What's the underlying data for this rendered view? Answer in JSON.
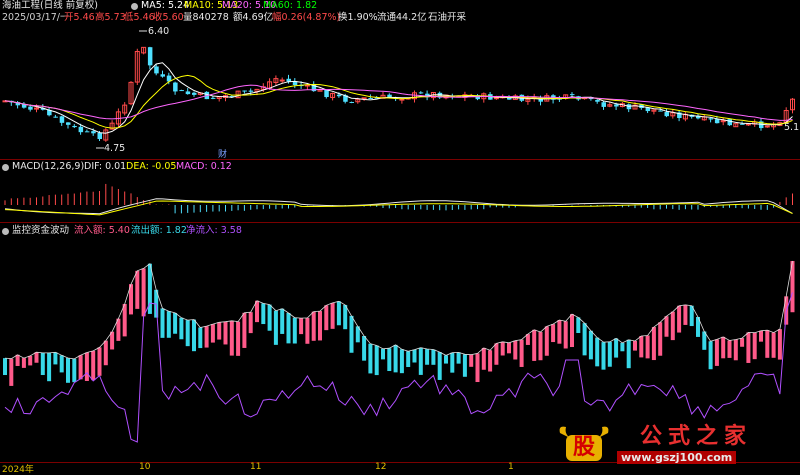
{
  "colors": {
    "bg": "#000000",
    "up": "#ff4a4a",
    "down": "#4fe0ff",
    "ma5": "#ffffff",
    "ma10": "#ffff00",
    "ma20": "#ff66ff",
    "ma60": "#00ff00",
    "sep": "#7a0000",
    "inflow": "#ff5a8a",
    "outflow": "#38d8e8",
    "net": "#b050ff"
  },
  "header": {
    "title": "海油工程(日线 前复权)",
    "ma5": "MA5: 5.24",
    "ma10": "MA10: 5.13",
    "ma20": "MA20: 5.10",
    "ma60": "MA60: 1.82",
    "date": "2025/03/17/一",
    "open": "开5.46",
    "high": "高5.73",
    "low": "低5.46",
    "close": "收5.60",
    "volume": "量840278",
    "amount": "额4.69亿",
    "change": "幅0.26(4.87%)",
    "turnover": "换1.90%",
    "float": "流通44.2亿",
    "sector": "石油开采"
  },
  "price_labels": {
    "max": "6.40",
    "min": "4.75",
    "cur": "5.1",
    "cai": "财"
  },
  "macd": {
    "label": "MACD(12,26,9)",
    "dif": "DIF: 0.01",
    "dea": "DEA: -0.05",
    "macd": "MACD: 0.12"
  },
  "fund": {
    "label": "监控资金波动",
    "inflow": "流入额: 5.40",
    "outflow": "流出额: 1.82",
    "net": "净流入: 3.58"
  },
  "xaxis": [
    "2024年",
    "10",
    "11",
    "12",
    "1"
  ],
  "watermark": {
    "char": "股",
    "brand": "公式之家",
    "url": "www.gszj100.com"
  }
}
